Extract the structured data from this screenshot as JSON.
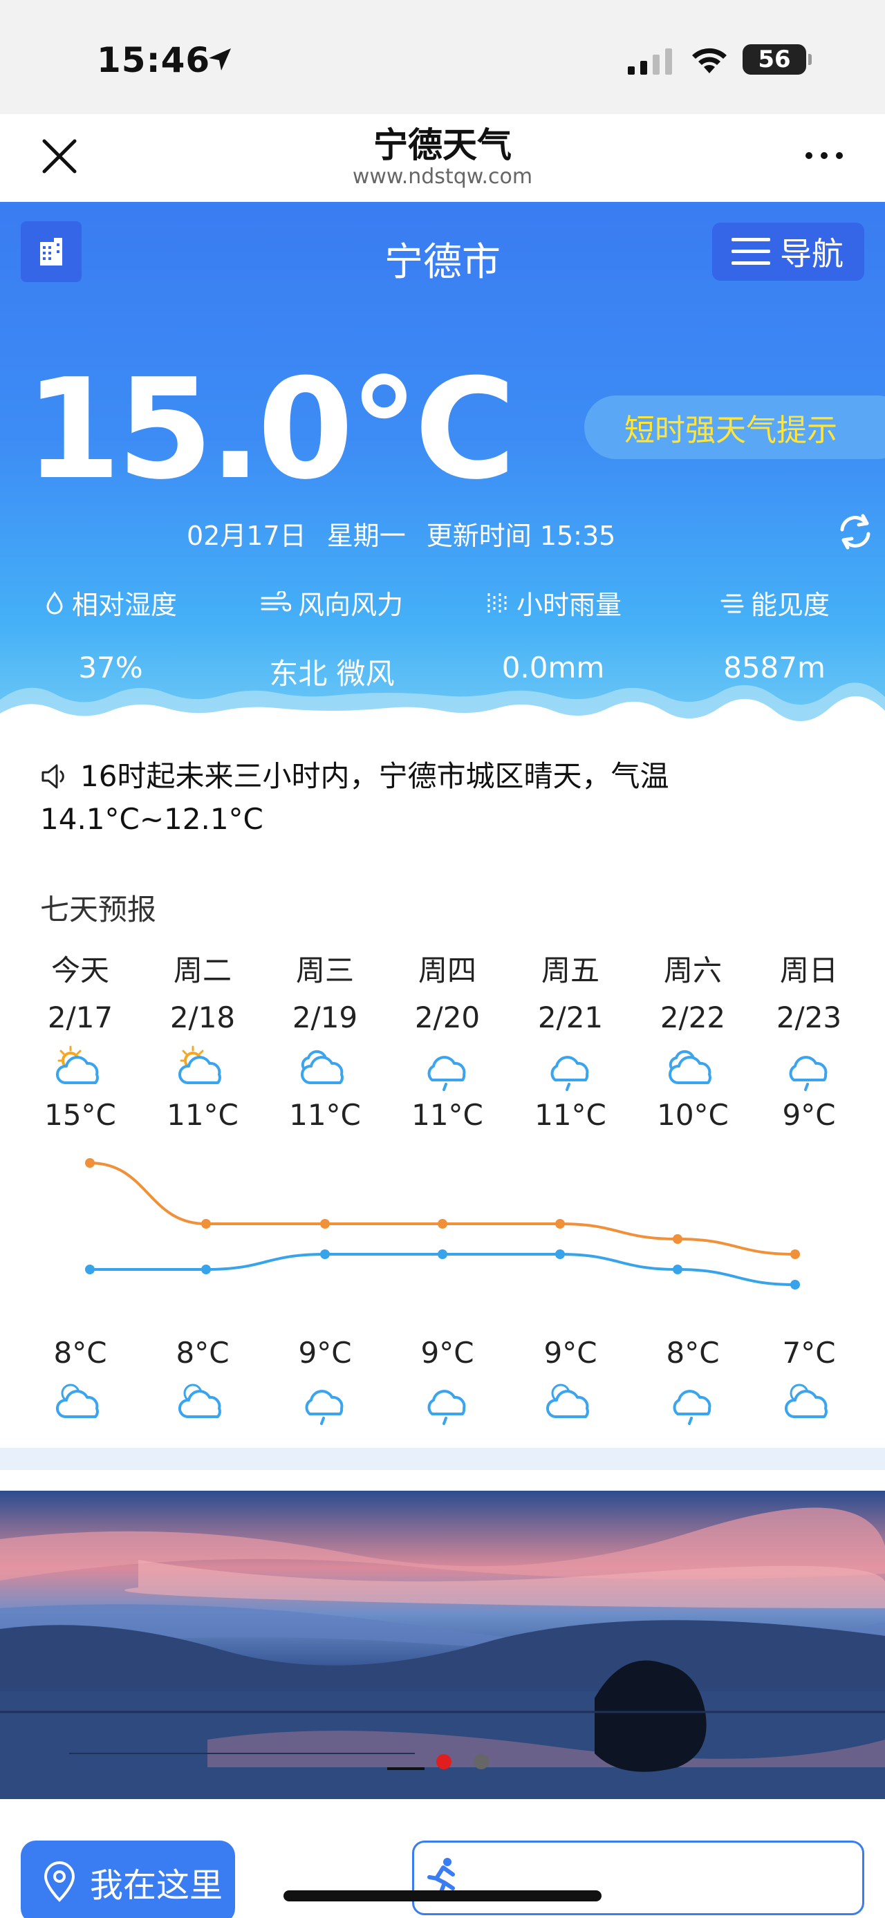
{
  "status_bar": {
    "time": "15:46",
    "battery": "56"
  },
  "browser": {
    "title": "宁德天气",
    "url": "www.ndstqw.com"
  },
  "header": {
    "city": "宁德市",
    "nav_label": "导航"
  },
  "current": {
    "temperature": "15.0°C",
    "alert": "短时强天气提示",
    "date": "02月17日",
    "weekday": "星期一",
    "updated": "更新时间 15:35"
  },
  "metrics": [
    {
      "label": "相对湿度",
      "value": "37%",
      "icon": "humidity-icon"
    },
    {
      "label": "风向风力",
      "value": "东北 微风",
      "icon": "wind-icon"
    },
    {
      "label": "小时雨量",
      "value": "0.0mm",
      "icon": "rain-gauge-icon"
    },
    {
      "label": "能见度",
      "value": "8587m",
      "icon": "visibility-icon"
    }
  ],
  "notice": "16时起未来三小时内，宁德市城区晴天，气温14.1°C~12.1°C",
  "forecast": {
    "title": "七天预报",
    "days": [
      {
        "name": "今天",
        "date": "2/17",
        "high": "15°C",
        "low": "8°C",
        "day_icon": "sun-cloud-icon",
        "night_icon": "moon-cloud-icon"
      },
      {
        "name": "周二",
        "date": "2/18",
        "high": "11°C",
        "low": "8°C",
        "day_icon": "sun-cloud-icon",
        "night_icon": "moon-cloud-icon"
      },
      {
        "name": "周三",
        "date": "2/19",
        "high": "11°C",
        "low": "9°C",
        "day_icon": "cloudy-icon",
        "night_icon": "rain-cloud-icon"
      },
      {
        "name": "周四",
        "date": "2/20",
        "high": "11°C",
        "low": "9°C",
        "day_icon": "rain-cloud-icon",
        "night_icon": "rain-cloud-icon"
      },
      {
        "name": "周五",
        "date": "2/21",
        "high": "11°C",
        "low": "9°C",
        "day_icon": "rain-cloud-icon",
        "night_icon": "moon-cloud-icon"
      },
      {
        "name": "周六",
        "date": "2/22",
        "high": "10°C",
        "low": "8°C",
        "day_icon": "cloudy-icon",
        "night_icon": "rain-cloud-icon"
      },
      {
        "name": "周日",
        "date": "2/23",
        "high": "9°C",
        "low": "7°C",
        "day_icon": "rain-cloud-icon",
        "night_icon": "moon-cloud-icon"
      }
    ],
    "high_values": [
      15,
      11,
      11,
      11,
      11,
      10,
      9
    ],
    "low_values": [
      8,
      8,
      9,
      9,
      9,
      8,
      7
    ],
    "colors": {
      "high": "#f0913a",
      "low": "#37a3ea"
    }
  },
  "bottom": {
    "here_label": "我在这里"
  }
}
